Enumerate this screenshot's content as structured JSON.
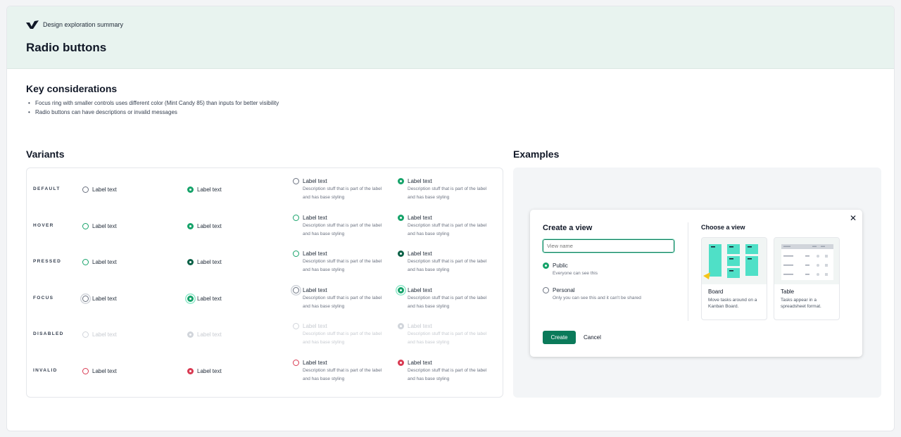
{
  "header": {
    "brand": "Design exploration summary",
    "title": "Radio buttons"
  },
  "key_considerations": {
    "title": "Key considerations",
    "items": [
      "Focus ring with smaller controls uses different color (Mint Candy 85) than inputs for better visibility",
      "Radio buttons can have descriptions or invalid messages"
    ]
  },
  "variants": {
    "title": "Variants",
    "label_text": "Label text",
    "description_text": "Description stuff that is part of the label and has base styling",
    "rows": [
      {
        "state": "DEFAULT",
        "ring": "#6b7280",
        "fill": "#16a36a",
        "text": "#1f2937",
        "desc": "#6b7280"
      },
      {
        "state": "HOVER",
        "ring": "#16a36a",
        "fill": "#16a36a",
        "text": "#1f2937",
        "desc": "#6b7280"
      },
      {
        "state": "PRESSED",
        "ring": "#16a36a",
        "fill": "#0b6147",
        "text": "#1f2937",
        "desc": "#6b7280"
      },
      {
        "state": "FOCUS",
        "ring": "#6b7280",
        "fill": "#16a36a",
        "text": "#1f2937",
        "desc": "#6b7280"
      },
      {
        "state": "DISABLED",
        "ring": "#d1d5db",
        "fill": "#d1d5db",
        "text": "#c7cbd1",
        "desc": "#c7cbd1"
      },
      {
        "state": "INVALID",
        "ring": "#d93a52",
        "fill": "#d93a52",
        "text": "#1f2937",
        "desc": "#6b7280"
      }
    ]
  },
  "examples": {
    "title": "Examples",
    "dialog": {
      "title": "Create a view",
      "input_placeholder": "View name",
      "options": [
        {
          "label": "Public",
          "description": "Everyone can see this",
          "checked": true
        },
        {
          "label": "Personal",
          "description": "Only you can see this and it can't be shared",
          "checked": false
        }
      ],
      "choose_title": "Choose a view",
      "views": [
        {
          "name": "Board",
          "description": "Move tasks around on a Kanban Board."
        },
        {
          "name": "Table",
          "description": "Tasks appear in a spreadsheet format."
        }
      ],
      "create_label": "Create",
      "cancel_label": "Cancel"
    }
  },
  "colors": {
    "accent": "#0b7a5a",
    "header_bg": "#e8f3ef",
    "mint": "#4fe0c7",
    "warning": "#f5c518"
  }
}
